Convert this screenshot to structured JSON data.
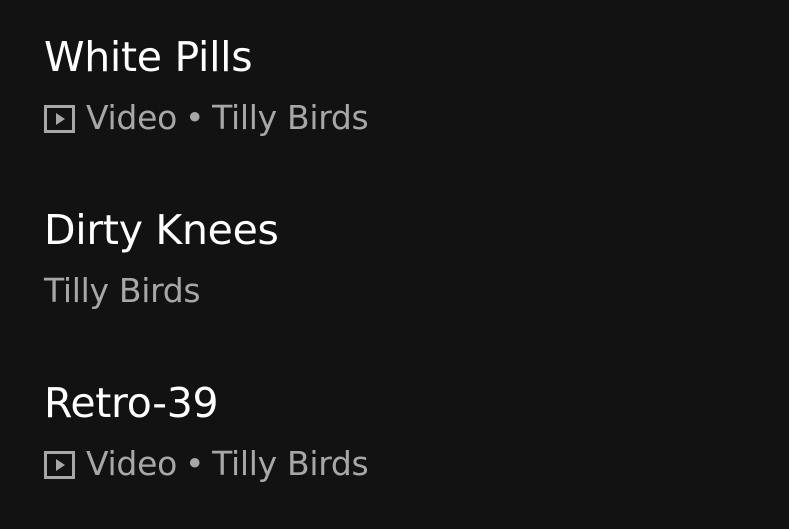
{
  "results": [
    {
      "title": "White Pills",
      "has_video_icon": true,
      "type_label": "Video",
      "separator": "•",
      "artist": "Tilly Birds"
    },
    {
      "title": "Dirty Knees",
      "has_video_icon": false,
      "artist": "Tilly Birds"
    },
    {
      "title": "Retro-39",
      "has_video_icon": true,
      "type_label": "Video",
      "separator": "•",
      "artist": "Tilly Birds"
    }
  ],
  "icons": {
    "video": "video-play-icon"
  },
  "colors": {
    "background": "#121212",
    "title": "#ffffff",
    "subtitle": "#a7a7a7"
  }
}
